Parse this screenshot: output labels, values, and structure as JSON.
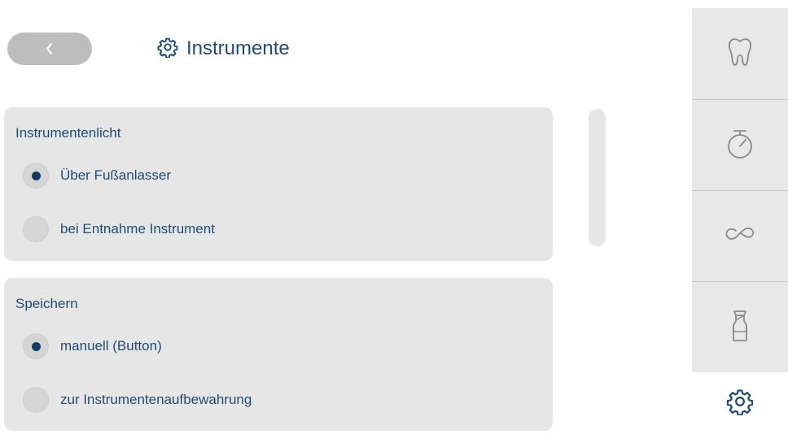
{
  "header": {
    "title": "Instrumente",
    "back_icon": "chevron-left-icon",
    "title_icon": "gear-icon"
  },
  "sections": [
    {
      "heading": "Instrumentenlicht",
      "options": [
        {
          "label": "Über Fußanlasser",
          "selected": true
        },
        {
          "label": "bei Entnahme Instrument",
          "selected": false
        }
      ]
    },
    {
      "heading": "Speichern",
      "options": [
        {
          "label": "manuell (Button)",
          "selected": true
        },
        {
          "label": "zur Instrumentenaufbewahrung",
          "selected": false
        }
      ]
    }
  ],
  "sidebar": {
    "items": [
      {
        "icon": "tooth-icon"
      },
      {
        "icon": "stopwatch-icon"
      },
      {
        "icon": "infinity-icon"
      },
      {
        "icon": "spray-bottle-icon"
      }
    ],
    "active_item": {
      "icon": "gear-icon"
    }
  },
  "colors": {
    "text": "#1f4c76",
    "card_bg": "#e6e6e6",
    "radio_dot": "#12395e",
    "back_button": "#bdbdbd",
    "sidebar_bg": "#e8e8e8",
    "sidebar_icon": "#8a8a8a"
  }
}
